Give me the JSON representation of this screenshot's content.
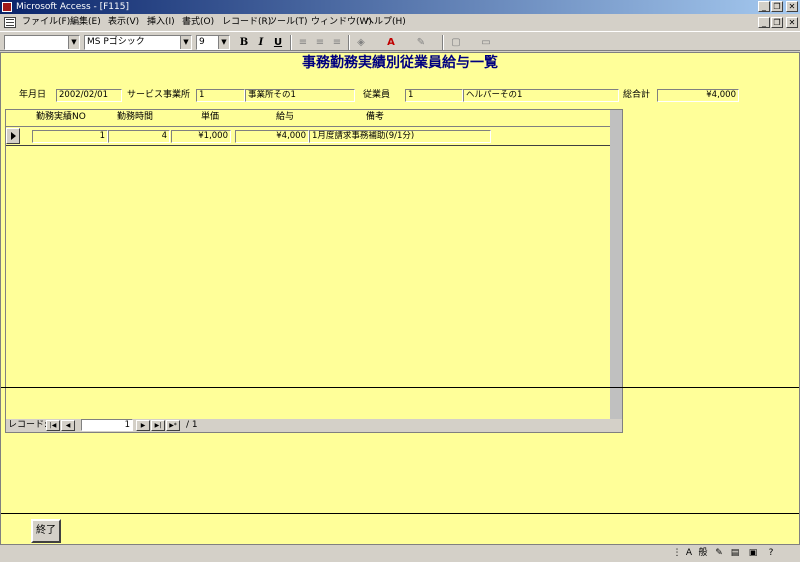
{
  "window": {
    "title": "Microsoft Access - [F115]"
  },
  "menu": {
    "items": [
      "ファイル(F)",
      "編集(E)",
      "表示(V)",
      "挿入(I)",
      "書式(O)",
      "レコード(R)",
      "ツール(T)",
      "ウィンドウ(W)",
      "ヘルプ(H)"
    ]
  },
  "toolbar": {
    "font_name": "MS Pゴシック",
    "font_size": "9",
    "bold": "B",
    "italic": "I",
    "underline": "U"
  },
  "form": {
    "title": "事務勤務実績別従業員給与一覧",
    "header": {
      "date_label": "年月日",
      "date_value": "2002/02/01",
      "office_label": "サービス事業所",
      "office_code": "1",
      "office_name": "事業所その1",
      "employee_label": "従業員",
      "employee_code": "1",
      "employee_name": "ヘルパーその1",
      "total_label": "総合計",
      "total_value": "¥4,000"
    },
    "columns": [
      "勤務実績NO",
      "勤務時間",
      "単価",
      "給与",
      "備考"
    ],
    "rows": [
      {
        "no": "1",
        "hours": "4",
        "unit_price": "¥1,000",
        "salary": "¥4,000",
        "note": "1月度請求事務補助(9/1分)"
      }
    ],
    "nav": {
      "label": "レコード:",
      "current": "1",
      "total": "/ 1"
    },
    "close_label": "終了"
  },
  "colors": {
    "form_bg": "#ffff99",
    "title_color": "#000080",
    "titlebar_start": "#0a246a",
    "titlebar_end": "#a6caf0"
  },
  "ime": {
    "mode": "A",
    "kanji": "般"
  }
}
